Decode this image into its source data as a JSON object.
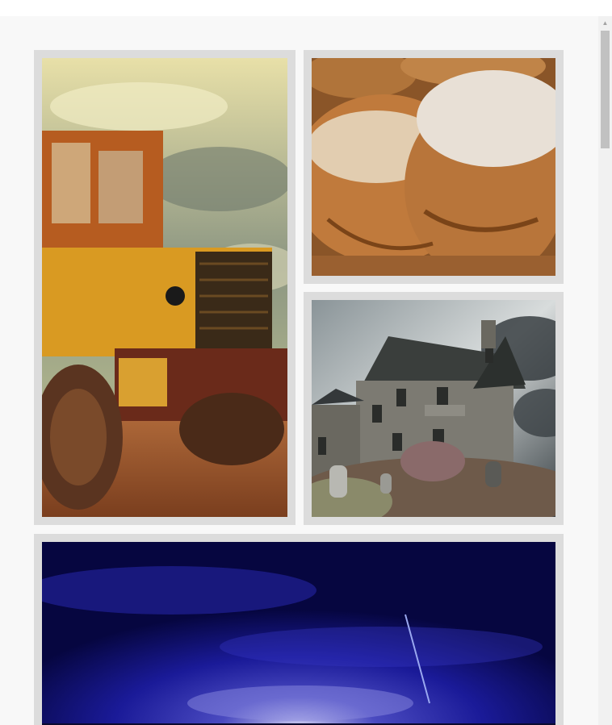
{
  "gallery": {
    "tiles": [
      {
        "subject": "tractor-photo"
      },
      {
        "subject": "bread-photo"
      },
      {
        "subject": "haunted-house-photo"
      },
      {
        "subject": "night-sky-photo"
      }
    ]
  },
  "scrollbar": {
    "up_arrow_icon": "triangle-up-icon"
  },
  "colors": {
    "tile_frame": "#dcdcdc",
    "page_bg": "#f8f8f8",
    "scroll_track": "#f1f1f1",
    "scroll_thumb": "#c1c1c1"
  }
}
